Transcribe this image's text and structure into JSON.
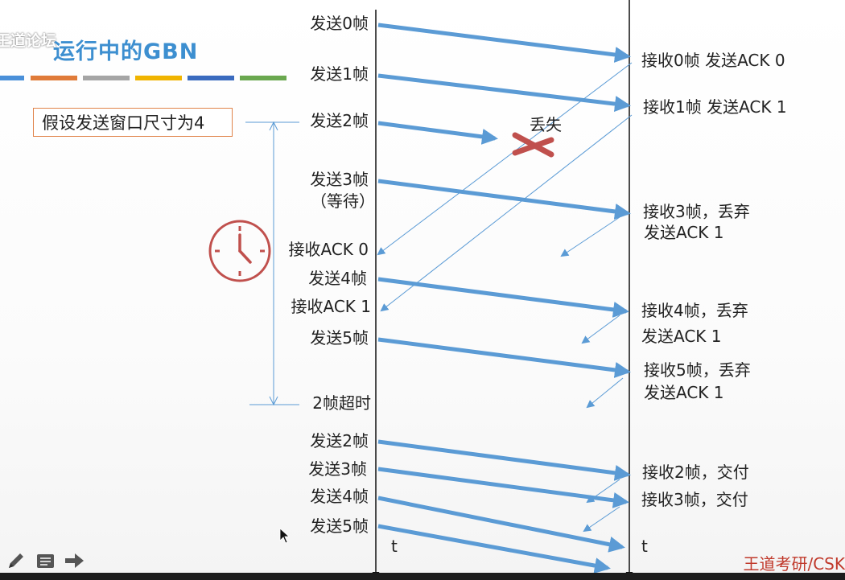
{
  "header": {
    "watermark": "王道论坛",
    "title": "运行中的GBN"
  },
  "stripe_colors": [
    "#4a90d9",
    "#e07b39",
    "#a5a5a5",
    "#f0b400",
    "#3a6bbf",
    "#6aa84f"
  ],
  "assumption": "假设发送窗口尺寸为4",
  "lost_label": "丢失",
  "timeout_label": "2帧超时",
  "sender_labels": [
    "发送0帧",
    "发送1帧",
    "发送2帧",
    "发送3帧",
    "（等待）",
    "接收ACK 0",
    "发送4帧",
    "接收ACK 1",
    "发送5帧",
    "发送2帧",
    "发送3帧",
    "发送4帧",
    "发送5帧"
  ],
  "receiver_labels": [
    "接收0帧 发送ACK 0",
    "接收1帧 发送ACK 1",
    "接收3帧，丢弃",
    "发送ACK 1",
    "接收4帧，丢弃",
    "发送ACK 1",
    "接收5帧，丢弃",
    "发送ACK 1",
    "接收2帧，交付",
    "接收3帧，交付"
  ],
  "time_labels": {
    "sender": "t",
    "receiver": "t"
  },
  "brand": "王道考研/CSK",
  "colors": {
    "arrow": "#5b9bd5",
    "clock": "#c0504d",
    "lost_x": "#c0504d",
    "brand": "#c0392b"
  },
  "icons": [
    "clock-icon",
    "pencil-icon",
    "notes-icon",
    "next-arrow-icon",
    "mouse-cursor-icon"
  ]
}
